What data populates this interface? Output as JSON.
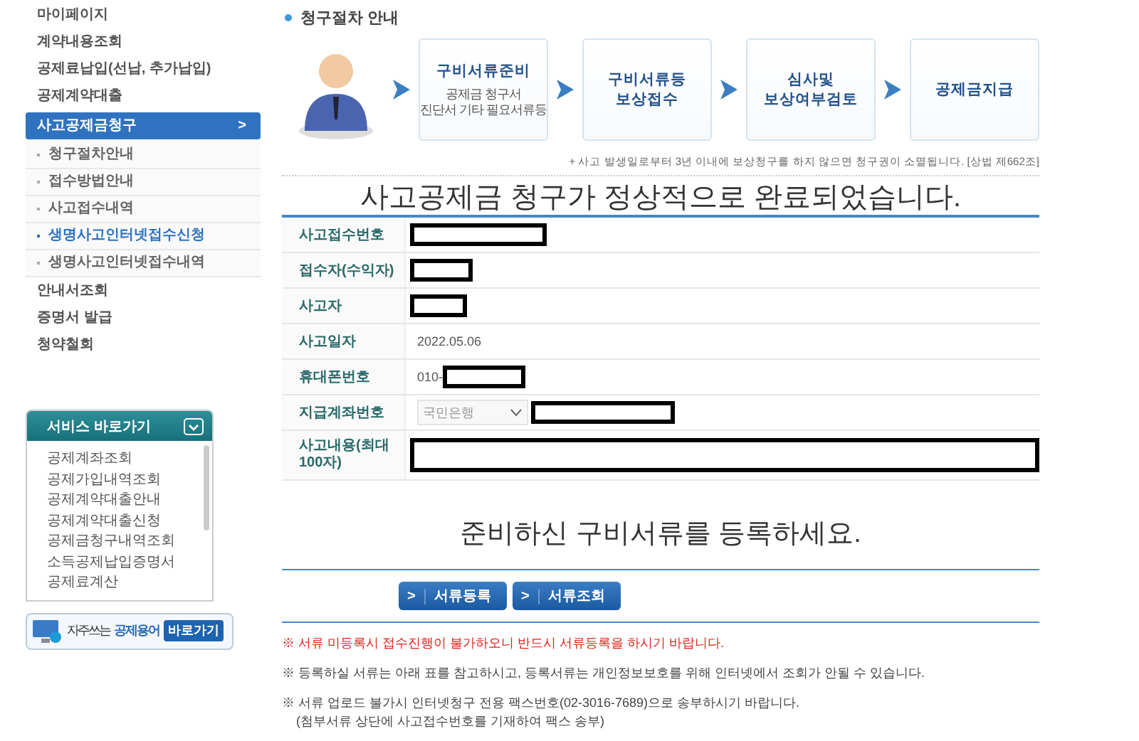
{
  "sidebar": {
    "items": [
      {
        "label": "마이페이지",
        "selected": false
      },
      {
        "label": "계약내용조회",
        "selected": false
      },
      {
        "label": "공제료납입(선납, 추가납입)",
        "selected": false
      },
      {
        "label": "공제계약대출",
        "selected": false
      },
      {
        "label": "사고공제금청구",
        "selected": true,
        "arrow": ">",
        "children": [
          {
            "label": "청구절차안내",
            "selected": false
          },
          {
            "label": "접수방법안내",
            "selected": false
          },
          {
            "label": "사고접수내역",
            "selected": false
          },
          {
            "label": "생명사고인터넷접수신청",
            "selected": true
          },
          {
            "label": "생명사고인터넷접수내역",
            "selected": false
          }
        ]
      },
      {
        "label": "안내서조회",
        "selected": false
      },
      {
        "label": "증명서 발급",
        "selected": false
      },
      {
        "label": "청약철회",
        "selected": false
      }
    ]
  },
  "service_box": {
    "title": "서비스 바로가기",
    "links": [
      "공제계좌조회",
      "공제가입내역조회",
      "공제계약대출안내",
      "공제계약대출신청",
      "공제금청구내역조회",
      "소득공제납입증명서",
      "공제료계산"
    ]
  },
  "glossary_banner": {
    "text": "자주쓰는",
    "highlight": "공제용어",
    "button": "바로가기"
  },
  "section_title": "청구절차 안내",
  "steps": [
    {
      "title": "구비서류준비",
      "desc": "공제금 청구서\n진단서 기타 필요서류등"
    },
    {
      "title": "구비서류등\n보상접수"
    },
    {
      "title": "심사및\n보상여부검토"
    },
    {
      "title": "공제금지급"
    }
  ],
  "notice": "+ 사고 발생일로부터 3년 이내에 보상청구를 하지 않으면 청구권이 소멸됩니다. [상법 제662조]",
  "complete_heading": "사고공제금 청구가 정상적으로 완료되었습니다.",
  "form_rows": [
    {
      "label": "사고접수번호",
      "redacted": true
    },
    {
      "label": "접수자(수익자)",
      "redacted": true
    },
    {
      "label": "사고자",
      "redacted": true
    },
    {
      "label": "사고일자",
      "value": "2022.05.06",
      "redacted": false
    },
    {
      "label": "휴대폰번호",
      "value": "010-",
      "redacted": true
    },
    {
      "label": "지급계좌번호",
      "bank": "국민은행",
      "redacted": true
    },
    {
      "label": "사고내용(최대 100자)",
      "redacted": true
    }
  ],
  "register_heading": "준비하신 구비서류를 등록하세요.",
  "buttons": [
    {
      "arrow": ">",
      "label": "서류등록"
    },
    {
      "arrow": ">",
      "label": "서류조회"
    }
  ],
  "notes": [
    {
      "text": "※ 서류 미등록시 접수진행이 불가하오니 반드시 서류등록을 하시기 바랍니다.",
      "warning": true
    },
    {
      "text": "※ 등록하실 서류는 아래 표를 참고하시고, 등록서류는 개인정보보호를 위해 인터넷에서 조회가 안될 수 있습니다.",
      "warning": false
    },
    {
      "text": "※ 서류 업로드 불가시 인터넷청구 전용 팩스번호(02-3016-7689)으로 송부하시기 바랍니다.",
      "warning": false,
      "subline": "(첨부서류 상단에 사고접수번호를 기재하여 팩스 송부)"
    }
  ]
}
